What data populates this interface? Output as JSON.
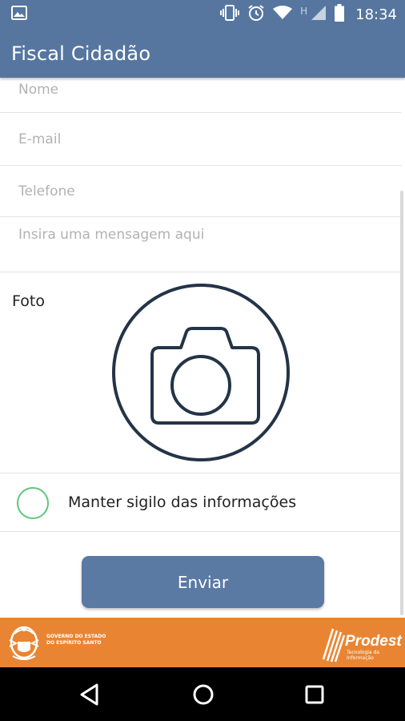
{
  "status_bar": {
    "time": "18:34",
    "network_letter": "H",
    "icons": [
      "image-notification-icon",
      "vibrate-icon",
      "alarm-icon",
      "wifi-icon",
      "cell-signal-icon",
      "battery-icon"
    ]
  },
  "app_bar": {
    "title": "Fiscal Cidadão"
  },
  "form": {
    "nome_placeholder": "Nome",
    "email_placeholder": "E-mail",
    "telefone_placeholder": "Telefone",
    "mensagem_placeholder": "Insira uma mensagem aqui",
    "photo_label": "Foto",
    "photo_icon": "camera-icon",
    "sigilo_label": "Manter sigilo das informações",
    "sigilo_checked": false,
    "send_label": "Enviar"
  },
  "footer": {
    "gov_line1": "GOVERNO DO ESTADO",
    "gov_line2": "DO ESPÍRITO SANTO",
    "prodest_name": "Prodest",
    "prodest_sub": "Tecnologia da Informação"
  },
  "nav": {
    "icons": [
      "back-icon",
      "home-icon",
      "recents-icon"
    ]
  },
  "colors": {
    "primary": "#56769f",
    "button": "#5a7aa4",
    "footer": "#e98532",
    "radio_border": "#5fc77a",
    "camera_stroke": "#243447"
  }
}
